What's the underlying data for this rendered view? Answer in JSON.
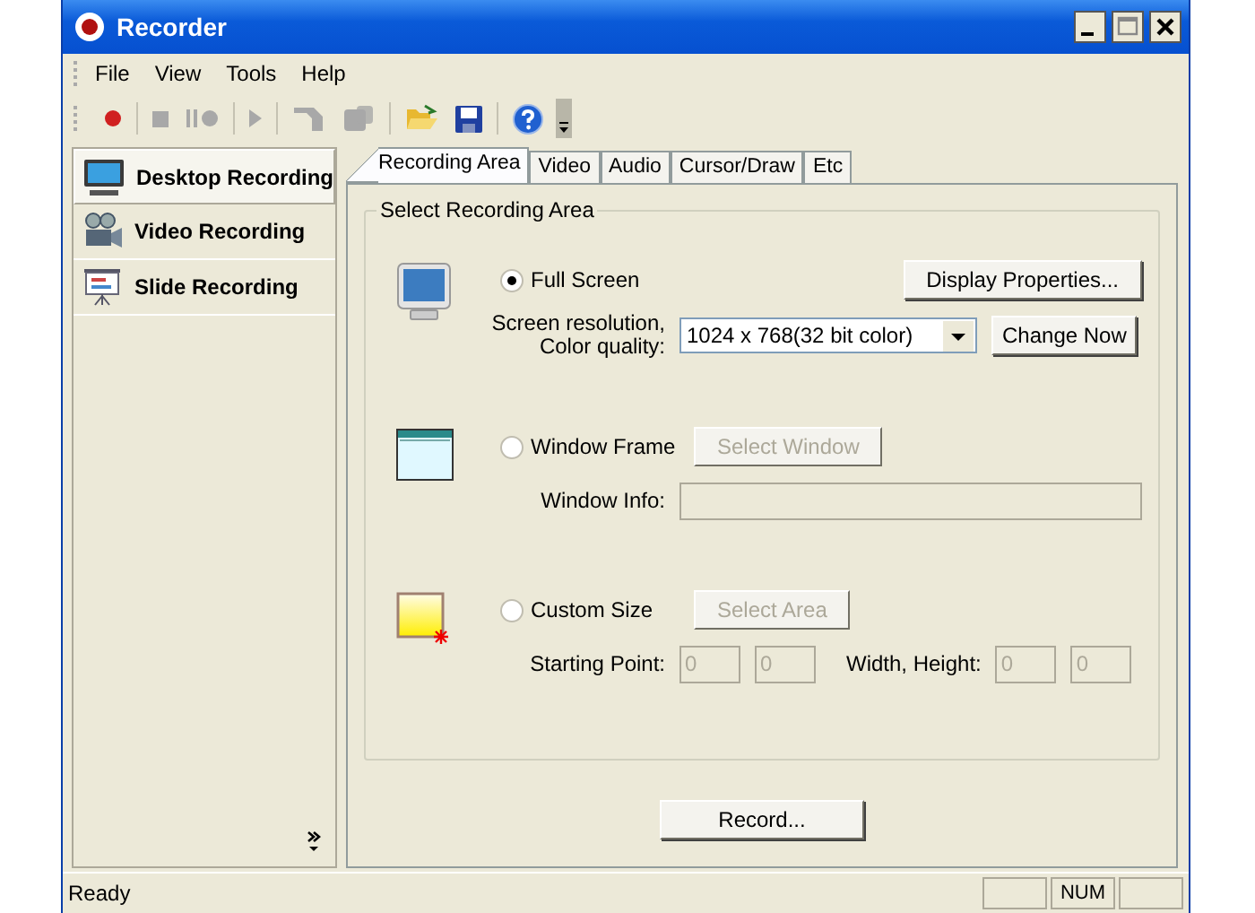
{
  "window": {
    "title": "Recorder"
  },
  "menu": [
    "File",
    "View",
    "Tools",
    "Help"
  ],
  "toolbar": [
    [
      {
        "kind": "record",
        "disabled": false
      }
    ],
    [
      {
        "kind": "stop",
        "disabled": true
      },
      {
        "kind": "pause",
        "disabled": true
      }
    ],
    [
      {
        "kind": "play",
        "disabled": true
      }
    ],
    [
      {
        "kind": "edit",
        "disabled": true
      },
      {
        "kind": "export",
        "disabled": true
      }
    ],
    [
      {
        "kind": "open",
        "disabled": false
      },
      {
        "kind": "save",
        "disabled": false
      }
    ],
    [
      {
        "kind": "help",
        "disabled": false
      }
    ]
  ],
  "sidebar": {
    "items": [
      {
        "label": "Desktop Recording",
        "kind": "desktop",
        "selected": true
      },
      {
        "label": "Video Recording",
        "kind": "video",
        "selected": false
      },
      {
        "label": "Slide Recording",
        "kind": "slide",
        "selected": false
      }
    ]
  },
  "tabs": [
    {
      "label": "Recording Area",
      "selected": true
    },
    {
      "label": "Video",
      "selected": false
    },
    {
      "label": "Audio",
      "selected": false
    },
    {
      "label": "Cursor/Draw",
      "selected": false
    },
    {
      "label": "Etc",
      "selected": false
    }
  ],
  "group": {
    "title": "Select Recording Area",
    "options": [
      {
        "kind": "full_screen",
        "label": "Full Screen",
        "selected": true,
        "button": {
          "label": "Display Properties...",
          "disabled": false
        },
        "items": [
          {
            "kind": "label",
            "text": "Screen resolution,\nColor quality:"
          },
          {
            "kind": "select",
            "value": "1024 x 768(32 bit color)"
          },
          {
            "kind": "button",
            "label": "Change Now",
            "disabled": false
          }
        ]
      },
      {
        "kind": "window",
        "label": "Window Frame",
        "selected": false,
        "button": {
          "label": "Select Window",
          "disabled": true
        },
        "items": [
          {
            "kind": "label",
            "text": "Window Info:"
          },
          {
            "kind": "field",
            "disabled": true
          }
        ]
      },
      {
        "kind": "custom",
        "label": "Custom Size",
        "selected": false,
        "button": {
          "label": "Select Area",
          "disabled": true
        },
        "items": [
          {
            "kind": "label",
            "text": "Starting Point:"
          },
          {
            "kind": "field",
            "value": "0",
            "disabled": true
          },
          {
            "kind": "field",
            "value": "0",
            "disabled": true
          },
          {
            "kind": "label",
            "text": "Width, Height:"
          },
          {
            "kind": "field",
            "value": "0",
            "disabled": true
          },
          {
            "kind": "field",
            "value": "0",
            "disabled": true
          }
        ]
      }
    ]
  },
  "footer": {
    "button": "Record..."
  },
  "status_bar": {
    "text": "Ready",
    "indicators": [
      "NUM"
    ]
  }
}
